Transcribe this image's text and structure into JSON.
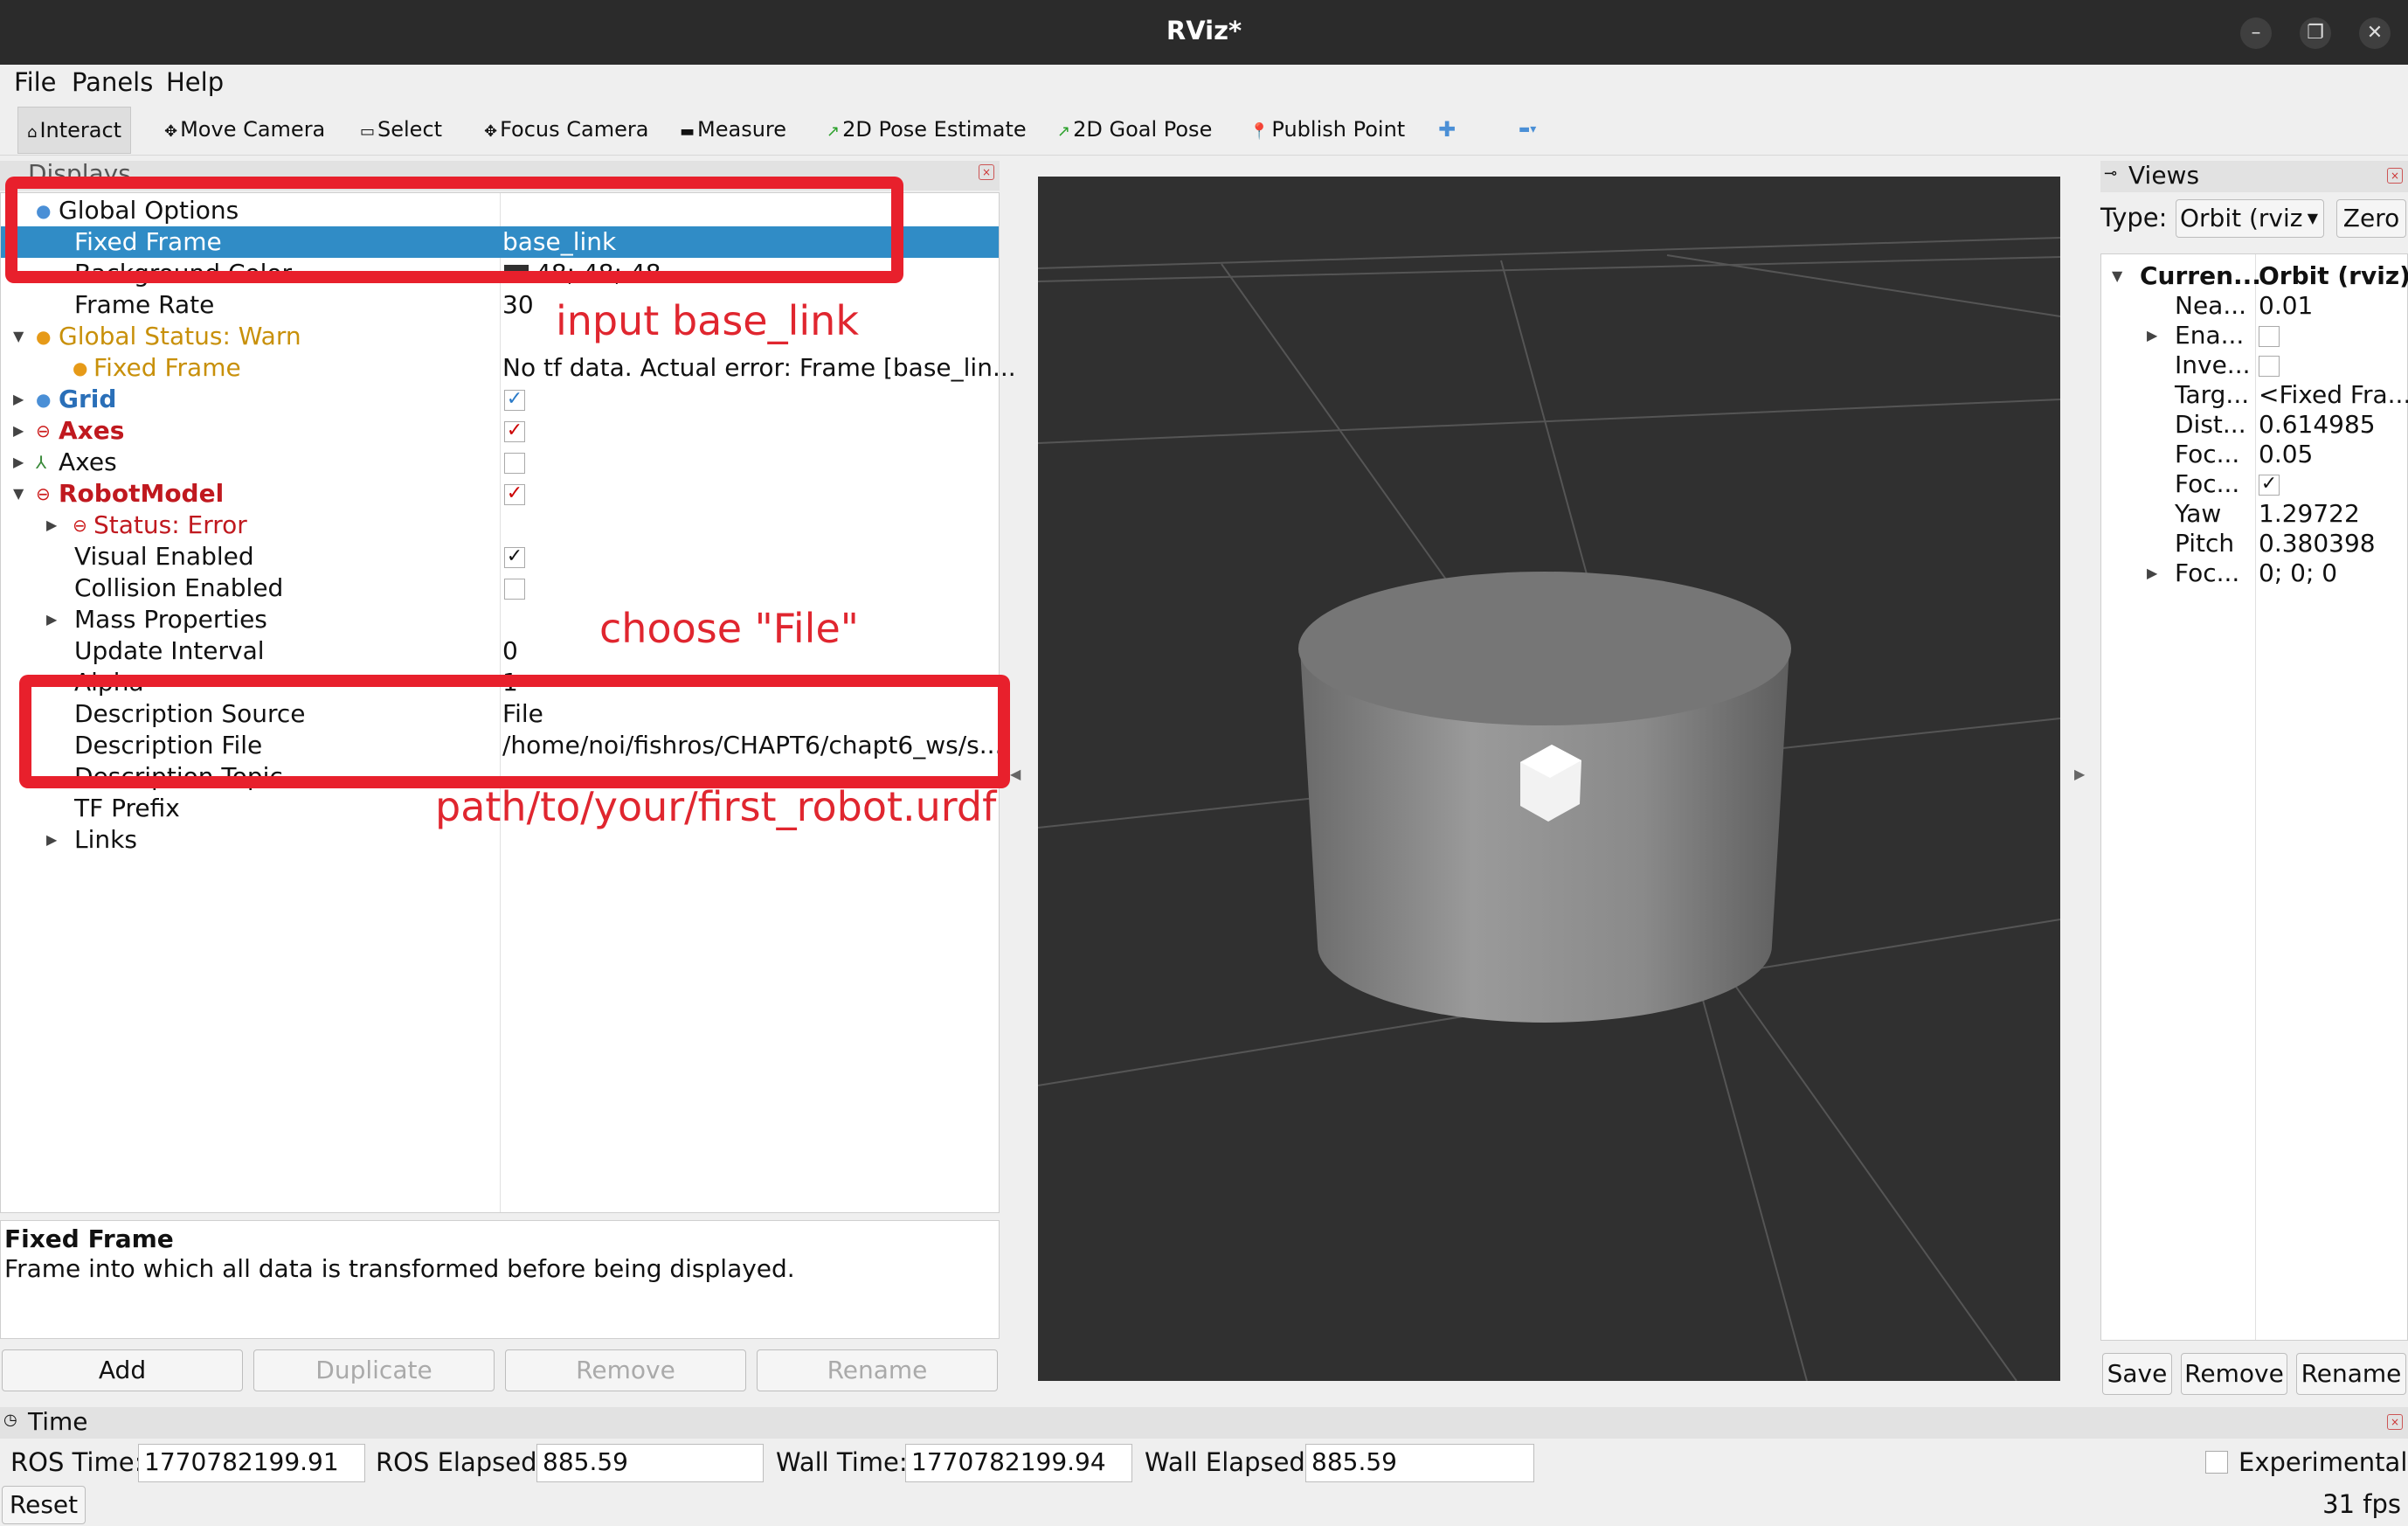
{
  "window": {
    "title": "RViz*",
    "controls": [
      "–",
      "❐",
      "✕"
    ]
  },
  "menu": [
    "File",
    "Panels",
    "Help"
  ],
  "toolbar": [
    {
      "label": "Interact",
      "icon": "cursor-icon",
      "glyph": "⌂"
    },
    {
      "label": "Move Camera",
      "icon": "move-camera-icon",
      "glyph": "✥"
    },
    {
      "label": "Select",
      "icon": "select-icon",
      "glyph": "▭"
    },
    {
      "label": "Focus Camera",
      "icon": "focus-camera-icon",
      "glyph": "✥"
    },
    {
      "label": "Measure",
      "icon": "measure-icon",
      "glyph": "▬"
    },
    {
      "label": "2D Pose Estimate",
      "icon": "pose-estimate-icon",
      "glyph": "↗"
    },
    {
      "label": "2D Goal Pose",
      "icon": "goal-pose-icon",
      "glyph": "↗"
    },
    {
      "label": "Publish Point",
      "icon": "publish-point-icon",
      "glyph": "📍"
    }
  ],
  "displays": {
    "header": "Displays",
    "rows": [
      {
        "name": "Global Options",
        "value": "",
        "indent": 1,
        "arrow": "",
        "icon": "●",
        "iconColor": "#4a8fd6",
        "style": "normal"
      },
      {
        "name": "Fixed Frame",
        "value": "base_link",
        "indent": 2,
        "arrow": "",
        "icon": "",
        "style": "selected"
      },
      {
        "name": "Background Color",
        "value": "48; 48; 48",
        "indent": 2,
        "arrow": "",
        "icon": "",
        "style": "normal",
        "swatch": "#303030"
      },
      {
        "name": "Frame Rate",
        "value": "30",
        "indent": 2,
        "arrow": "",
        "icon": "",
        "style": "normal"
      },
      {
        "name": "Global Status: Warn",
        "value": "",
        "indent": 1,
        "arrow": "▼",
        "icon": "●",
        "iconColor": "#e69a18",
        "style": "warn"
      },
      {
        "name": "Fixed Frame",
        "value": "No tf data.  Actual error: Frame [base_lin...",
        "indent": 2,
        "arrow": "",
        "icon": "●",
        "iconColor": "#e69a18",
        "style": "warn"
      },
      {
        "name": "Grid",
        "value": "",
        "indent": 1,
        "arrow": "▶",
        "icon": "●",
        "iconColor": "#4a8fd6",
        "style": "blue",
        "check": "blue"
      },
      {
        "name": "Axes",
        "value": "",
        "indent": 1,
        "arrow": "▶",
        "icon": "⊖",
        "iconColor": "#cc1b1b",
        "style": "error",
        "check": "red"
      },
      {
        "name": "Axes",
        "value": "",
        "indent": 1,
        "arrow": "▶",
        "icon": "⅄",
        "iconColor": "#3a8a3a",
        "style": "normal",
        "check": "empty"
      },
      {
        "name": "RobotModel",
        "value": "",
        "indent": 1,
        "arrow": "▼",
        "icon": "⊖",
        "iconColor": "#cc1b1b",
        "style": "error",
        "check": "red"
      },
      {
        "name": "Status: Error",
        "value": "",
        "indent": 2,
        "arrow": "▶",
        "icon": "⊖",
        "iconColor": "#cc1b1b",
        "style": "error-plain"
      },
      {
        "name": "Visual Enabled",
        "value": "",
        "indent": 2,
        "arrow": "",
        "icon": "",
        "style": "normal",
        "check": "black"
      },
      {
        "name": "Collision Enabled",
        "value": "",
        "indent": 2,
        "arrow": "",
        "icon": "",
        "style": "normal",
        "check": "empty"
      },
      {
        "name": "Mass Properties",
        "value": "",
        "indent": 2,
        "arrow": "▶",
        "icon": "",
        "style": "normal"
      },
      {
        "name": "Update Interval",
        "value": "0",
        "indent": 2,
        "arrow": "",
        "icon": "",
        "style": "normal"
      },
      {
        "name": "Alpha",
        "value": "1",
        "indent": 2,
        "arrow": "",
        "icon": "",
        "style": "normal"
      },
      {
        "name": "Description Source",
        "value": "File",
        "indent": 2,
        "arrow": "",
        "icon": "",
        "style": "normal"
      },
      {
        "name": "Description File",
        "value": "/home/noi/fishros/CHAPT6/chapt6_ws/s...",
        "indent": 2,
        "arrow": "",
        "icon": "",
        "style": "normal"
      },
      {
        "name": "Description Topic",
        "value": "",
        "indent": 2,
        "arrow": "",
        "icon": "",
        "style": "normal"
      },
      {
        "name": "TF Prefix",
        "value": "",
        "indent": 2,
        "arrow": "",
        "icon": "",
        "style": "normal"
      },
      {
        "name": "Links",
        "value": "",
        "indent": 2,
        "arrow": "▶",
        "icon": "",
        "style": "normal"
      }
    ],
    "description_title": "Fixed Frame",
    "description_text": "Frame into which all data is transformed before being displayed.",
    "buttons": [
      "Add",
      "Duplicate",
      "Remove",
      "Rename"
    ]
  },
  "annotations": {
    "a1": "input base_link",
    "a2": "choose \"File\"",
    "a3": "path/to/your/first_robot.urdf"
  },
  "views": {
    "header": "Views",
    "type_label": "Type:",
    "type_value": "Orbit (rviz",
    "zero_label": "Zero",
    "rows": [
      {
        "name": "Curren...",
        "value": "Orbit (rviz)",
        "arrow": "▼",
        "bold": true,
        "indent": 0
      },
      {
        "name": "Nea...",
        "value": "0.01",
        "arrow": "",
        "indent": 1
      },
      {
        "name": "Ena...",
        "value": "",
        "arrow": "▶",
        "indent": 1,
        "check": "empty"
      },
      {
        "name": "Inve...",
        "value": "",
        "arrow": "",
        "indent": 1,
        "check": "empty"
      },
      {
        "name": "Targ...",
        "value": "<Fixed Fra...",
        "arrow": "",
        "indent": 1
      },
      {
        "name": "Dist...",
        "value": "0.614985",
        "arrow": "",
        "indent": 1
      },
      {
        "name": "Foc...",
        "value": "0.05",
        "arrow": "",
        "indent": 1
      },
      {
        "name": "Foc...",
        "value": "",
        "arrow": "",
        "indent": 1,
        "check": "black"
      },
      {
        "name": "Yaw",
        "value": "1.29722",
        "arrow": "",
        "indent": 1
      },
      {
        "name": "Pitch",
        "value": "0.380398",
        "arrow": "",
        "indent": 1
      },
      {
        "name": "Foc...",
        "value": "0; 0; 0",
        "arrow": "▶",
        "indent": 1
      }
    ],
    "buttons": [
      "Save",
      "Remove",
      "Rename"
    ]
  },
  "time": {
    "header": "Time",
    "ros_time_label": "ROS Time:",
    "ros_time": "1770782199.91",
    "ros_elapsed_label": "ROS Elapsed:",
    "ros_elapsed": "885.59",
    "wall_time_label": "Wall Time:",
    "wall_time": "1770782199.94",
    "wall_elapsed_label": "Wall Elapsed:",
    "wall_elapsed": "885.59",
    "experimental_label": "Experimental",
    "reset_label": "Reset",
    "fps": "31 fps"
  },
  "colors": {
    "selection": "#308cc6",
    "annotation": "#e0262f",
    "viewport": "#303030"
  }
}
